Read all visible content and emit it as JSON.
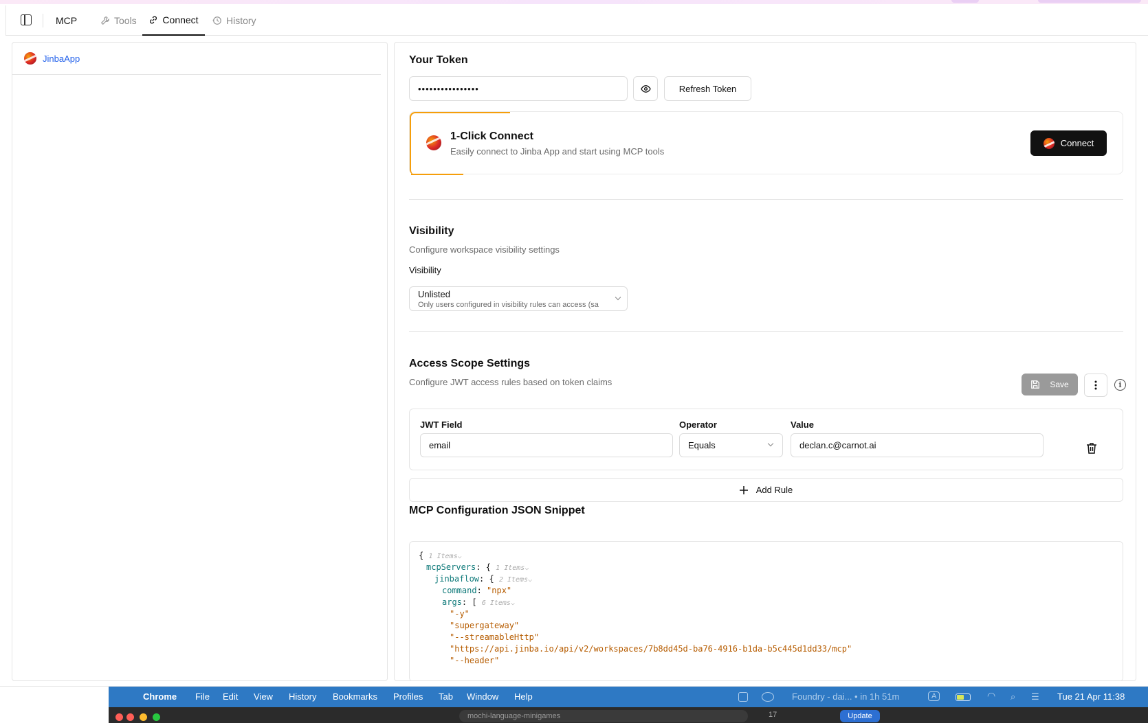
{
  "app": {
    "name": "MCP",
    "tabs": [
      {
        "label": "Tools",
        "icon": "wrench-icon"
      },
      {
        "label": "Connect",
        "icon": "link-icon"
      },
      {
        "label": "History",
        "icon": "history-icon"
      }
    ],
    "active_tab": "Connect"
  },
  "sidebar": {
    "items": [
      {
        "label": "JinbaApp",
        "icon": "jinba-logo-icon"
      }
    ]
  },
  "token": {
    "heading": "Your Token",
    "masked_value": "••••••••••••••••",
    "refresh_label": "Refresh Token"
  },
  "one_click": {
    "title": "1-Click Connect",
    "subtitle": "Easily connect to Jinba App and start using MCP tools",
    "button_label": "Connect"
  },
  "visibility": {
    "heading": "Visibility",
    "description": "Configure workspace visibility settings",
    "field_label": "Visibility",
    "selected_value": "Unlisted",
    "selected_hint": "Only users configured in visibility rules can access (sa"
  },
  "access_scope": {
    "heading": "Access Scope Settings",
    "description": "Configure JWT access rules based on token claims",
    "save_label": "Save",
    "columns": {
      "field": "JWT Field",
      "operator": "Operator",
      "value": "Value"
    },
    "rules": [
      {
        "field": "email",
        "operator": "Equals",
        "value": "declan.c@carnot.ai"
      }
    ],
    "add_rule_label": "Add Rule"
  },
  "json_snippet": {
    "heading": "MCP Configuration JSON Snippet",
    "root_meta": "1 Items",
    "mcpServers_key": "mcpServers",
    "mcpServers_meta": "1 Items",
    "server_key": "jinbaflow",
    "server_meta": "2 Items",
    "command_key": "command",
    "command_value": "\"npx\"",
    "args_key": "args",
    "args_meta": "6 Items",
    "args": [
      "\"-y\"",
      "\"supergateway\"",
      "\"--streamableHttp\"",
      "\"https://api.jinba.io/api/v2/workspaces/7b8dd45d-ba76-4916-b1da-b5c445d1dd33/mcp\"",
      "\"--header\""
    ]
  },
  "mac_menubar": {
    "app": "Chrome",
    "menus": [
      "File",
      "Edit",
      "View",
      "History",
      "Bookmarks",
      "Profiles",
      "Tab",
      "Window",
      "Help"
    ],
    "calendar_item": "Foundry - dai... • in 1h 51m",
    "input_indicator": "A",
    "datetime": "Tue 21 Apr  11:38"
  },
  "chrome_tabbar": {
    "url_text": "mochi-language-minigames",
    "tab_count": "17",
    "update_label": "Update"
  },
  "colors": {
    "accent_orange": "#f59e0b",
    "link_blue": "#2563eb",
    "json_key": "#0f7a7a",
    "json_string": "#b65c00",
    "macbar": "#2e79c4"
  }
}
